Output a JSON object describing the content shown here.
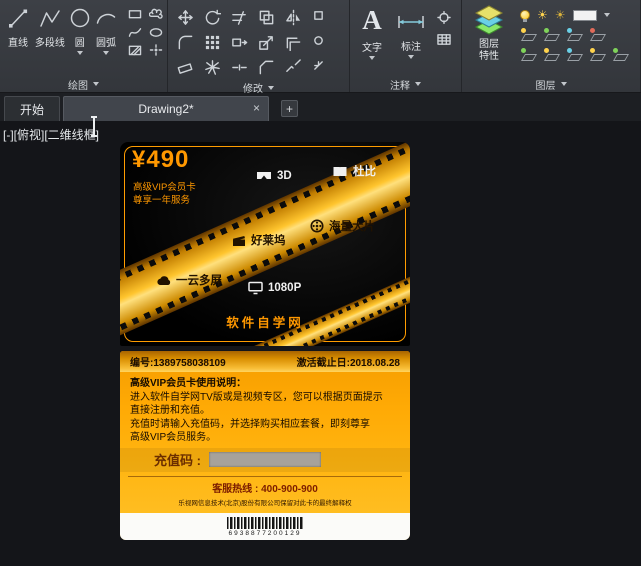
{
  "ribbon": {
    "draw": {
      "label": "绘图",
      "line": "直线",
      "polyline": "多段线",
      "circle": "圆",
      "arc": "圆弧"
    },
    "modify": {
      "label": "修改"
    },
    "annotate": {
      "label": "注释",
      "text": "文字",
      "dimension": "标注"
    },
    "layers": {
      "label": "图层",
      "properties": "图层特性"
    }
  },
  "tabs": {
    "start": "开始",
    "drawing": "Drawing2*",
    "close_glyph": "×",
    "new_glyph": "+"
  },
  "viewport": {
    "label": "[-][俯视][二维线框]"
  },
  "icons": {
    "text_glyph": "A",
    "sun_glyph": "☀"
  },
  "colors": {
    "accent_orange": "#ff9800",
    "card_orange": "#ffaa05",
    "film_gold": "#ffc52e"
  },
  "card": {
    "top": {
      "price": "¥490",
      "subtitle1": "高级VIP会员卡",
      "subtitle2": "尊享一年服务",
      "features": {
        "f3d": "3D",
        "dolby": "杜比",
        "hollywood": "好莱坞",
        "movies": "海量大片",
        "cloud": "一云多屏",
        "hd": "1080P"
      },
      "brand": "软件自学网"
    },
    "bottom": {
      "serial": "编号:1389758038109",
      "expiry": "激活截止日:2018.08.28",
      "usage_title": "高级VIP会员卡使用说明：",
      "usage_line1": "进入软件自学网TV版或是视频专区，您可以根据页面提示",
      "usage_line2": "直接注册和充值。",
      "usage_line3": "充值时请输入充值码，并选择购买相应套餐，即刻尊享",
      "usage_line4": "高级VIP会员服务。",
      "recharge_label": "充值码 :",
      "hotline": "客服热线 : 400-900-900",
      "legal": "乐视网信息技术(北京)股份有限公司保留对此卡的最终解释权",
      "barcode_number": "6938877200129"
    }
  }
}
